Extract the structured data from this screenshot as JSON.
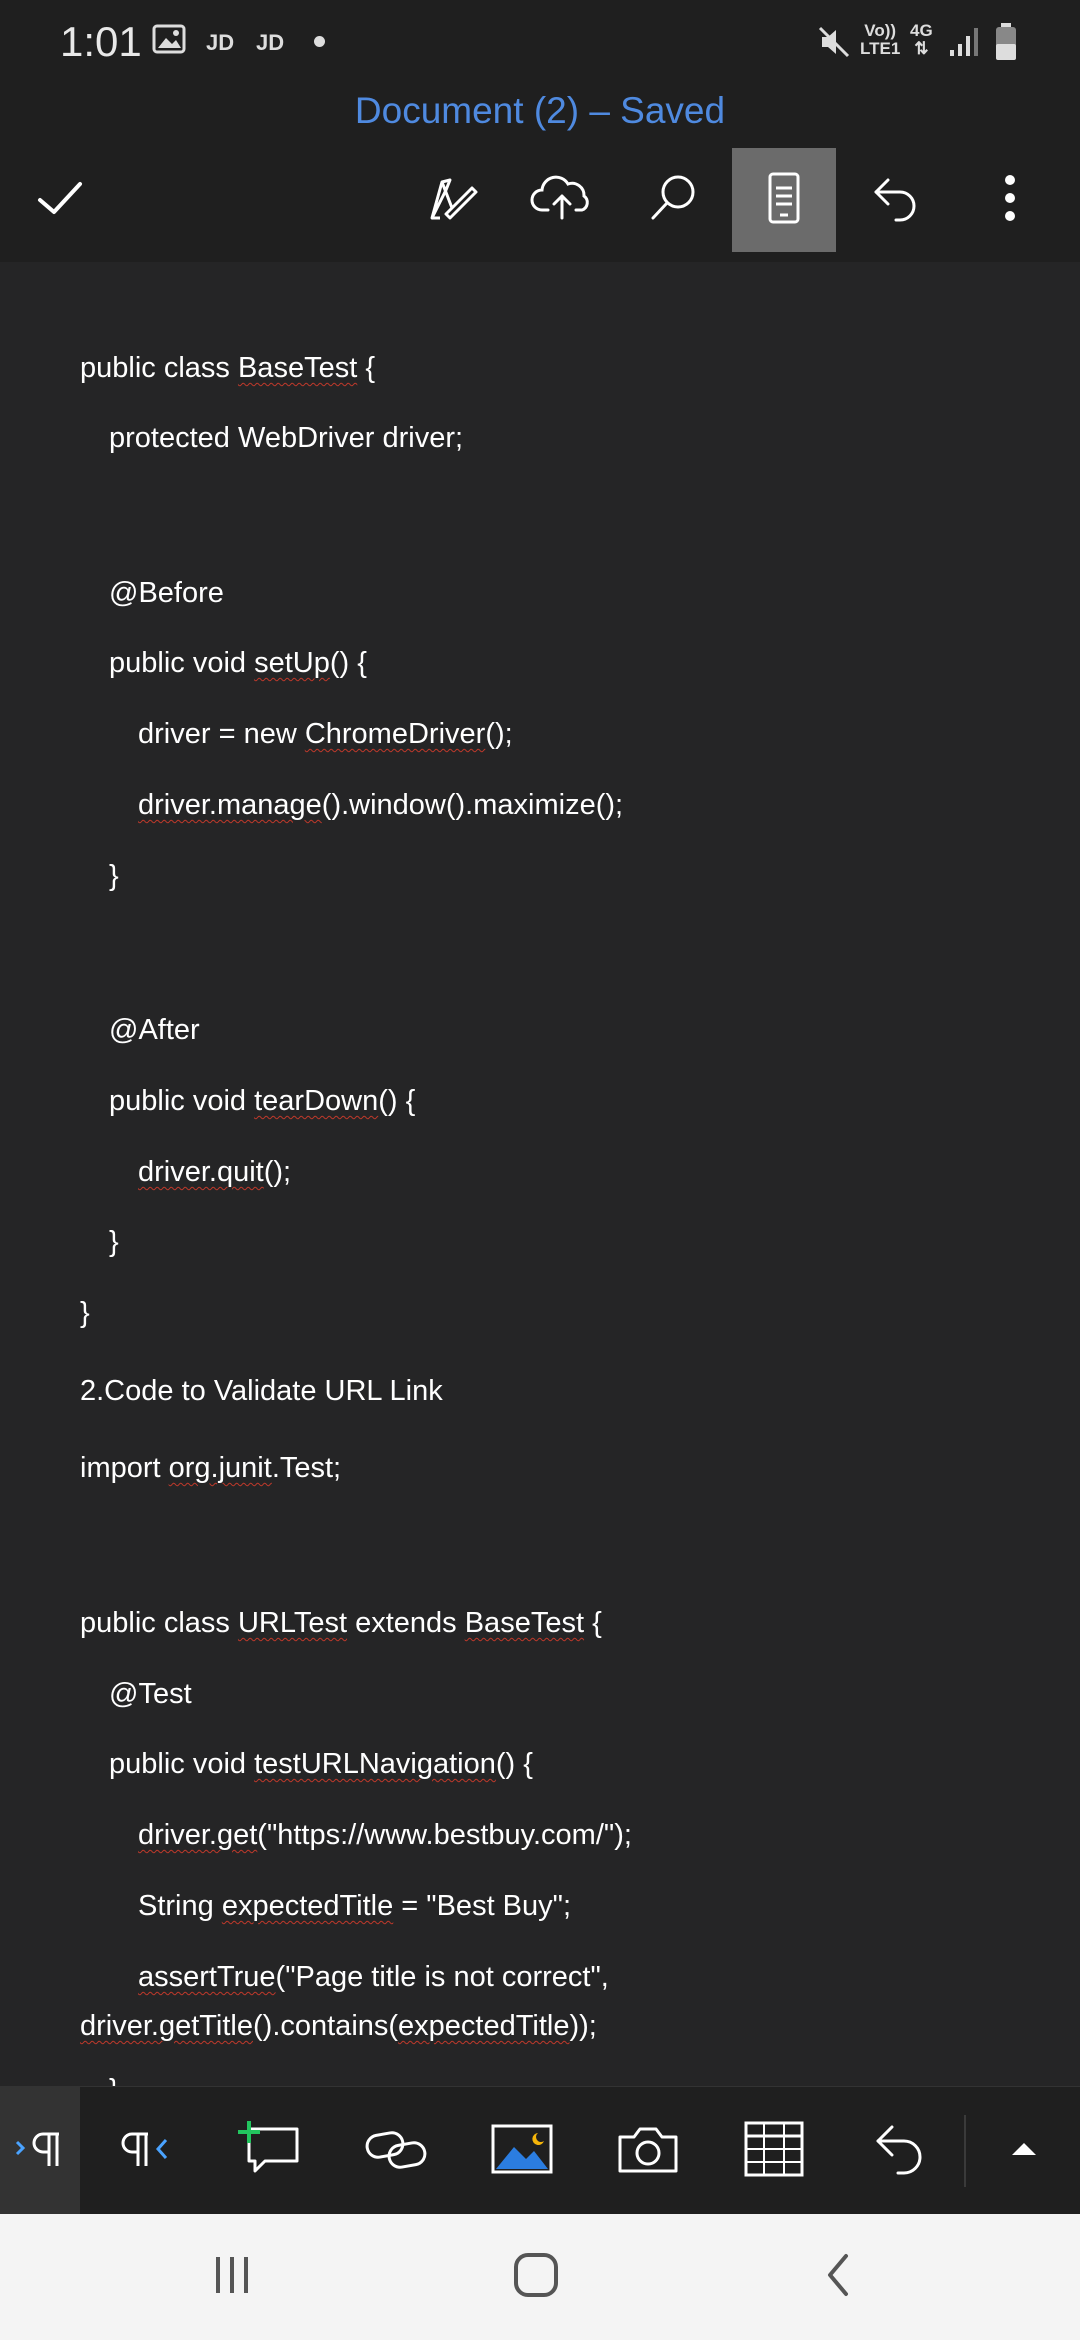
{
  "status_bar": {
    "time": "1:01",
    "jd1": "JD",
    "jd2": "JD",
    "net_top": "Vo))",
    "net_bottom": "LTE1",
    "net_type": "4G"
  },
  "title_bar": {
    "title": "Document (2) – Saved"
  },
  "toolbar": {
    "icons": [
      "check-icon",
      "pen-icon",
      "cloud-upload-icon",
      "search-icon",
      "mobile-view-icon",
      "undo-icon",
      "more-icon"
    ],
    "active": "mobile-view-icon"
  },
  "document": {
    "lines": [
      {
        "segments": [
          {
            "t": "public class "
          },
          {
            "t": "BaseTest",
            "sq": true
          },
          {
            "t": " {"
          }
        ]
      },
      {
        "segments": [
          {
            "t": "protected WebDriver driver;"
          }
        ]
      },
      {
        "segments": [
          {
            "t": "@Before"
          }
        ]
      },
      {
        "segments": [
          {
            "t": "public void "
          },
          {
            "t": "setUp",
            "sq": true
          },
          {
            "t": "() {"
          }
        ]
      },
      {
        "segments": [
          {
            "t": "driver = new "
          },
          {
            "t": "ChromeDriver",
            "sq": true
          },
          {
            "t": "();"
          }
        ]
      },
      {
        "segments": [
          {
            "t": "driver.manage",
            "sq": true
          },
          {
            "t": "().window().maximize();"
          }
        ]
      },
      {
        "segments": [
          {
            "t": "}"
          }
        ]
      },
      {
        "segments": [
          {
            "t": "@After"
          }
        ]
      },
      {
        "segments": [
          {
            "t": "public void "
          },
          {
            "t": "tearDown",
            "sq": true
          },
          {
            "t": "() {"
          }
        ]
      },
      {
        "segments": [
          {
            "t": "driver.quit",
            "sq": true
          },
          {
            "t": "();"
          }
        ]
      },
      {
        "segments": [
          {
            "t": "}"
          }
        ]
      },
      {
        "segments": [
          {
            "t": "}"
          }
        ]
      },
      {
        "segments": [
          {
            "t": "2.Code to Validate URL Link"
          }
        ]
      },
      {
        "segments": [
          {
            "t": "import "
          },
          {
            "t": "org.junit",
            "sq": true
          },
          {
            "t": ".Test;"
          }
        ]
      },
      {
        "segments": [
          {
            "t": "public class "
          },
          {
            "t": "URLTest",
            "sq": true
          },
          {
            "t": " extends "
          },
          {
            "t": "BaseTest",
            "sq": true
          },
          {
            "t": " {"
          }
        ]
      },
      {
        "segments": [
          {
            "t": "@Test"
          }
        ]
      },
      {
        "segments": [
          {
            "t": "public void "
          },
          {
            "t": "testURLNavigation",
            "sq": true
          },
          {
            "t": "() {"
          }
        ]
      },
      {
        "segments": [
          {
            "t": "driver.get",
            "sq": true
          },
          {
            "t": "(\"https://www.bestbuy.com/\");"
          }
        ]
      },
      {
        "segments": [
          {
            "t": "String "
          },
          {
            "t": "expectedTitle",
            "sq": true
          },
          {
            "t": " = \"Best Buy\";"
          }
        ]
      },
      {
        "segments": [
          {
            "t": "assertTrue",
            "sq": true
          },
          {
            "t": "(\"Page title is not correct\","
          }
        ]
      },
      {
        "segments": [
          {
            "t": "driver.getTitle",
            "sq": true
          },
          {
            "t": "().contains("
          },
          {
            "t": "expectedTitle",
            "sq": true
          },
          {
            "t": "));"
          }
        ]
      },
      {
        "segments": [
          {
            "t": "}"
          }
        ]
      }
    ]
  },
  "format_bar": {
    "icons": [
      "paragraph-marks-icon",
      "paragraph-rtl-icon",
      "insert-comment-icon",
      "insert-link-icon",
      "insert-picture-icon",
      "camera-icon",
      "insert-table-icon",
      "undo-icon",
      "collapse-up-icon"
    ]
  },
  "nav_bar": {
    "icons": [
      "recent-apps-icon",
      "home-icon",
      "back-icon"
    ]
  },
  "colors": {
    "title": "#4f8ae0",
    "background": "#252526",
    "chrome": "#1f1f1f",
    "active_button": "#6b6b6b",
    "squiggle": "#c0392b"
  }
}
